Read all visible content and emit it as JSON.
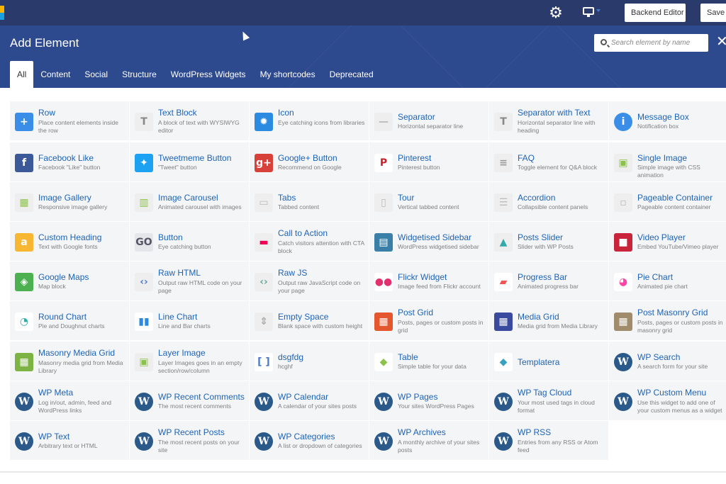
{
  "topbar": {
    "backend_editor_label": "Backend Editor",
    "save_label": "Save D"
  },
  "modal": {
    "title": "Add Element",
    "search_placeholder": "Search element by name",
    "close_symbol": "✕"
  },
  "tabs": [
    {
      "label": "All",
      "active": true
    },
    {
      "label": "Content"
    },
    {
      "label": "Social"
    },
    {
      "label": "Structure"
    },
    {
      "label": "WordPress Widgets"
    },
    {
      "label": "My shortcodes"
    },
    {
      "label": "Deprecated"
    }
  ],
  "elements": [
    {
      "name": "Row",
      "desc": "Place content elements inside the row",
      "icon": "plus-icon",
      "color": "#3b8ee8"
    },
    {
      "name": "Text Block",
      "desc": "A block of text with WYSIWYG editor",
      "icon": "text-icon",
      "color": "#eeeeee"
    },
    {
      "name": "Icon",
      "desc": "Eye catching icons from libraries",
      "icon": "sun-icon",
      "color": "#2a8be0"
    },
    {
      "name": "Separator",
      "desc": "Horizontal separator line",
      "icon": "separator-icon",
      "color": "#eeeeee"
    },
    {
      "name": "Separator with Text",
      "desc": "Horizontal separator line with heading",
      "icon": "separator-text-icon",
      "color": "#eeeeee"
    },
    {
      "name": "Message Box",
      "desc": "Notification box",
      "icon": "info-icon",
      "color": "#3b8ee8"
    },
    {
      "name": "Facebook Like",
      "desc": "Facebook \"Like\" button",
      "icon": "facebook-icon",
      "color": "#3b5998"
    },
    {
      "name": "Tweetmeme Button",
      "desc": "\"Tweet\" button",
      "icon": "twitter-icon",
      "color": "#1da1f2"
    },
    {
      "name": "Google+ Button",
      "desc": "Recommend on Google",
      "icon": "google-plus-icon",
      "color": "#d8413a"
    },
    {
      "name": "Pinterest",
      "desc": "Pinterest button",
      "icon": "pinterest-icon",
      "color": "#ffffff"
    },
    {
      "name": "FAQ",
      "desc": "Toggle element for Q&A block",
      "icon": "faq-icon",
      "color": "#eeeeee"
    },
    {
      "name": "Single Image",
      "desc": "Simple image with CSS animation",
      "icon": "image-icon",
      "color": "#eeeeee"
    },
    {
      "name": "Image Gallery",
      "desc": "Responsive image gallery",
      "icon": "gallery-icon",
      "color": "#eeeeee"
    },
    {
      "name": "Image Carousel",
      "desc": "Animated carousel with images",
      "icon": "carousel-icon",
      "color": "#eeeeee"
    },
    {
      "name": "Tabs",
      "desc": "Tabbed content",
      "icon": "tabs-icon",
      "color": "#eeeeee"
    },
    {
      "name": "Tour",
      "desc": "Vertical tabbed content",
      "icon": "tour-icon",
      "color": "#eeeeee"
    },
    {
      "name": "Accordion",
      "desc": "Collapsible content panels",
      "icon": "accordion-icon",
      "color": "#eeeeee"
    },
    {
      "name": "Pageable Container",
      "desc": "Pageable content container",
      "icon": "pageable-icon",
      "color": "#eeeeee"
    },
    {
      "name": "Custom Heading",
      "desc": "Text with Google fonts",
      "icon": "heading-icon",
      "color": "#f7b733"
    },
    {
      "name": "Button",
      "desc": "Eye catching button",
      "icon": "go-button-icon",
      "color": "#e4e6ea"
    },
    {
      "name": "Call to Action",
      "desc": "Catch visitors attention with CTA block",
      "icon": "cta-icon",
      "color": "#eeeeee"
    },
    {
      "name": "Widgetised Sidebar",
      "desc": "WordPress widgetised sidebar",
      "icon": "sidebar-icon",
      "color": "#3a7fa8"
    },
    {
      "name": "Posts Slider",
      "desc": "Slider with WP Posts",
      "icon": "slider-icon",
      "color": "#eeeeee"
    },
    {
      "name": "Video Player",
      "desc": "Embed YouTube/Vimeo player",
      "icon": "video-icon",
      "color": "#c8243a"
    },
    {
      "name": "Google Maps",
      "desc": "Map block",
      "icon": "map-icon",
      "color": "#4caf50"
    },
    {
      "name": "Raw HTML",
      "desc": "Output raw HTML code on your page",
      "icon": "html-icon",
      "color": "#eeeeee"
    },
    {
      "name": "Raw JS",
      "desc": "Output raw JavaScript code on your page",
      "icon": "js-icon",
      "color": "#eeeeee"
    },
    {
      "name": "Flickr Widget",
      "desc": "Image feed from Flickr account",
      "icon": "flickr-icon",
      "color": "#ffffff"
    },
    {
      "name": "Progress Bar",
      "desc": "Animated progress bar",
      "icon": "progress-icon",
      "color": "#ffffff"
    },
    {
      "name": "Pie Chart",
      "desc": "Animated pie chart",
      "icon": "pie-chart-icon",
      "color": "#ffffff"
    },
    {
      "name": "Round Chart",
      "desc": "Pie and Doughnut charts",
      "icon": "round-chart-icon",
      "color": "#ffffff"
    },
    {
      "name": "Line Chart",
      "desc": "Line and Bar charts",
      "icon": "line-chart-icon",
      "color": "#ffffff"
    },
    {
      "name": "Empty Space",
      "desc": "Blank space with custom height",
      "icon": "empty-space-icon",
      "color": "#eeeeee"
    },
    {
      "name": "Post Grid",
      "desc": "Posts, pages or custom posts in grid",
      "icon": "post-grid-icon",
      "color": "#e4572e"
    },
    {
      "name": "Media Grid",
      "desc": "Media grid from Media Library",
      "icon": "media-grid-icon",
      "color": "#3a4a9f"
    },
    {
      "name": "Post Masonry Grid",
      "desc": "Posts, pages or custom posts in masonry grid",
      "icon": "masonry-grid-icon",
      "color": "#a08c6a"
    },
    {
      "name": "Masonry Media Grid",
      "desc": "Masonry media grid from Media Library",
      "icon": "masonry-media-icon",
      "color": "#7cb342"
    },
    {
      "name": "Layer Image",
      "desc": "Layer Images goes in an empty section/row/column",
      "icon": "layer-image-icon",
      "color": "#eeeeee"
    },
    {
      "name": "dsgfdg",
      "desc": "hcghf",
      "icon": "shortcode-icon",
      "color": "#ffffff"
    },
    {
      "name": "Table",
      "desc": "Simple table for your data",
      "icon": "table-icon",
      "color": "#ffffff"
    },
    {
      "name": "Templatera",
      "desc": "",
      "icon": "templatera-icon",
      "color": "#ffffff"
    },
    {
      "name": "WP Search",
      "desc": "A search form for your site",
      "icon": "wordpress-icon",
      "color": "#2b5a8a"
    },
    {
      "name": "WP Meta",
      "desc": "Log in/out, admin, feed and WordPress links",
      "icon": "wordpress-icon",
      "color": "#2b5a8a"
    },
    {
      "name": "WP Recent Comments",
      "desc": "The most recent comments",
      "icon": "wordpress-icon",
      "color": "#2b5a8a"
    },
    {
      "name": "WP Calendar",
      "desc": "A calendar of your sites posts",
      "icon": "wordpress-icon",
      "color": "#2b5a8a"
    },
    {
      "name": "WP Pages",
      "desc": "Your sites WordPress Pages",
      "icon": "wordpress-icon",
      "color": "#2b5a8a"
    },
    {
      "name": "WP Tag Cloud",
      "desc": "Your most used tags in cloud format",
      "icon": "wordpress-icon",
      "color": "#2b5a8a"
    },
    {
      "name": "WP Custom Menu",
      "desc": "Use this widget to add one of your custom menus as a widget",
      "icon": "wordpress-icon",
      "color": "#2b5a8a"
    },
    {
      "name": "WP Text",
      "desc": "Arbitrary text or HTML",
      "icon": "wordpress-icon",
      "color": "#2b5a8a"
    },
    {
      "name": "WP Recent Posts",
      "desc": "The most recent posts on your site",
      "icon": "wordpress-icon",
      "color": "#2b5a8a"
    },
    {
      "name": "WP Categories",
      "desc": "A list or dropdown of categories",
      "icon": "wordpress-icon",
      "color": "#2b5a8a"
    },
    {
      "name": "WP Archives",
      "desc": "A monthly archive of your sites posts",
      "icon": "wordpress-icon",
      "color": "#2b5a8a"
    },
    {
      "name": "WP RSS",
      "desc": "Entries from any RSS or Atom feed",
      "icon": "wordpress-icon",
      "color": "#2b5a8a"
    }
  ]
}
